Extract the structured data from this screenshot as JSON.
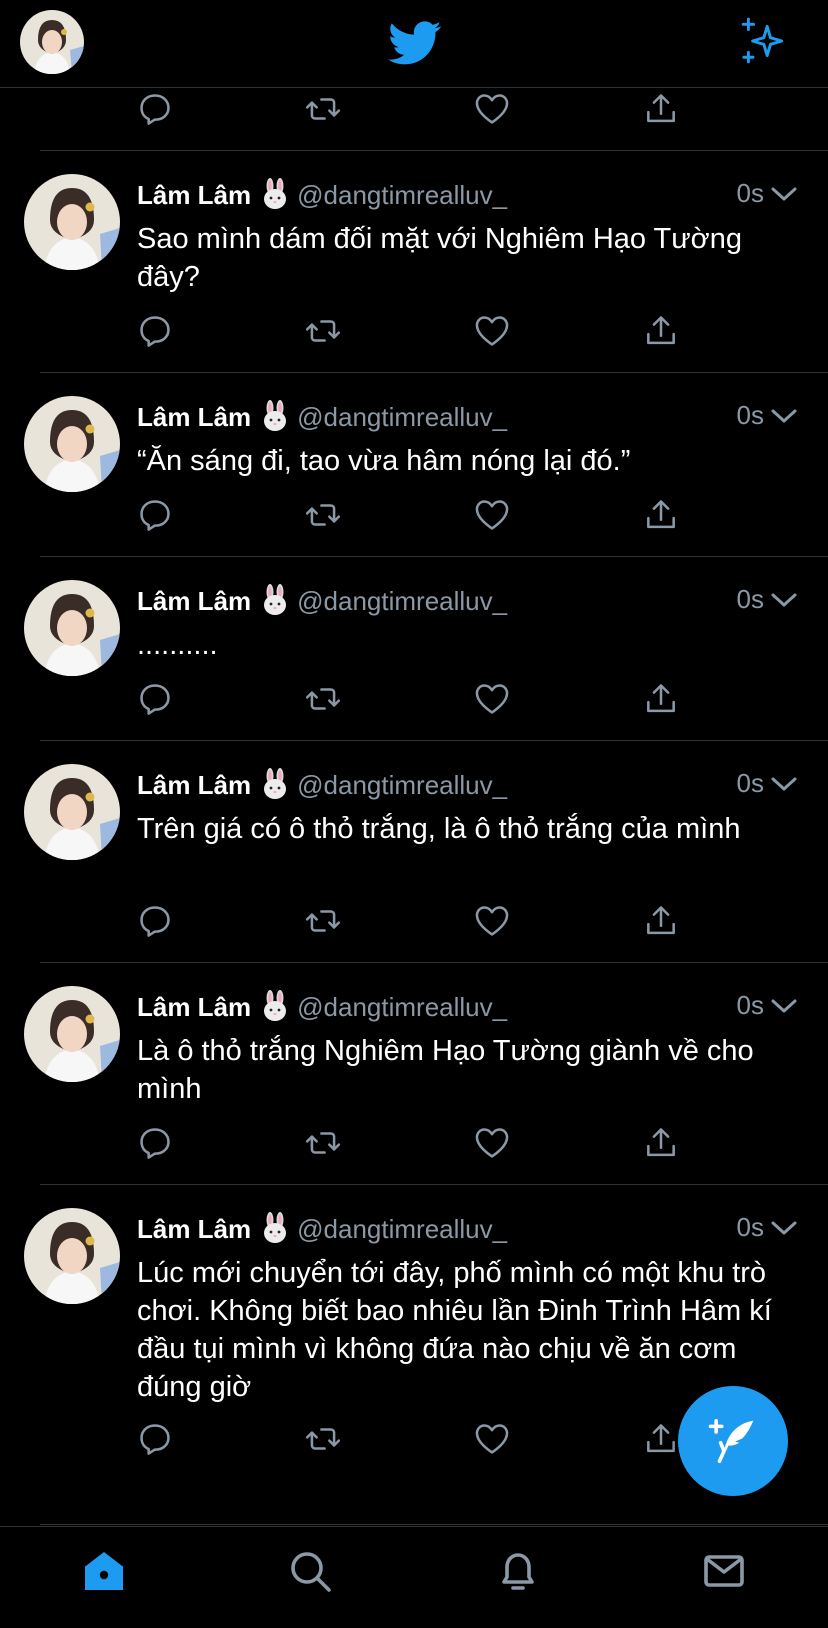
{
  "colors": {
    "accent": "#1d9bf0",
    "muted": "#8b98a5",
    "divider": "#2f3336",
    "background": "#000000"
  },
  "header": {
    "logo_icon": "twitter-bird-icon",
    "sparkle_icon": "sparkle-icon"
  },
  "tweets": [
    {
      "name": "Lâm Lâm",
      "handle": "@dangtimrealluv_",
      "time": "0s",
      "text": "Sao mình dám đối mặt với Nghiêm Hạo Tường đây?"
    },
    {
      "name": "Lâm Lâm",
      "handle": "@dangtimrealluv_",
      "time": "0s",
      "text": "“Ăn sáng đi, tao vừa hâm nóng lại đó.”"
    },
    {
      "name": "Lâm Lâm",
      "handle": "@dangtimrealluv_",
      "time": "0s",
      "text": ".........."
    },
    {
      "name": "Lâm Lâm",
      "handle": "@dangtimrealluv_",
      "time": "0s",
      "text": "Trên giá có ô thỏ trắng, là ô thỏ trắng của mình"
    },
    {
      "name": "Lâm Lâm",
      "handle": "@dangtimrealluv_",
      "time": "0s",
      "text": "Là ô thỏ trắng Nghiêm Hạo Tường giành về cho mình"
    },
    {
      "name": "Lâm Lâm",
      "handle": "@dangtimrealluv_",
      "time": "0s",
      "text": "Lúc mới chuyển tới đây, phố mình có một khu trò chơi. Không biết bao nhiêu lần Đinh Trình Hâm kí đầu tụi mình vì không đứa nào chịu về ăn cơm đúng giờ"
    }
  ],
  "bottom_nav": [
    "home-icon",
    "search-icon",
    "notifications-icon",
    "messages-icon"
  ]
}
